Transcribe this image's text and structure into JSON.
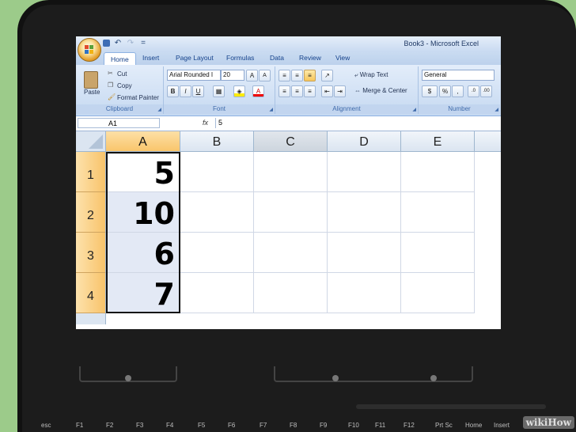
{
  "window": {
    "title": "Book3 - Microsoft Excel"
  },
  "quick_access": {
    "icons": [
      "save-icon",
      "undo-icon",
      "redo-icon"
    ],
    "undo_glyph": "↶",
    "redo_glyph": "↷",
    "more_glyph": "="
  },
  "tabs": [
    "Home",
    "Insert",
    "Page Layout",
    "Formulas",
    "Data",
    "Review",
    "View"
  ],
  "ribbon": {
    "clipboard": {
      "label": "Clipboard",
      "paste": "Paste",
      "cut": "Cut",
      "copy": "Copy",
      "format_painter": "Format Painter"
    },
    "font": {
      "label": "Font",
      "family": "Arial Rounded I",
      "size": "20",
      "bold": "B",
      "italic": "I",
      "underline": "U"
    },
    "alignment": {
      "label": "Alignment",
      "wrap_text": "Wrap Text",
      "merge_center": "Merge & Center"
    },
    "number": {
      "label": "Number",
      "format": "General",
      "percent": "%",
      "comma": ","
    }
  },
  "formula_bar": {
    "name_box": "A1",
    "fx": "fx",
    "value": "5"
  },
  "sheet": {
    "columns": [
      "A",
      "B",
      "C",
      "D",
      "E"
    ],
    "rows": [
      "1",
      "2",
      "3",
      "4"
    ],
    "column_a_values": [
      "5",
      "10",
      "6",
      "7"
    ]
  },
  "keyboard": {
    "keys": [
      "esc",
      "F1",
      "F2",
      "F3",
      "F4",
      "F5",
      "F6",
      "F7",
      "F8",
      "F9",
      "F10",
      "F11",
      "F12",
      "Prt Sc",
      "Home",
      "Insert"
    ]
  },
  "watermark": "wikiHow",
  "colors": {
    "selected_header": "#f9c56b",
    "ribbon": "#c6d9f1",
    "background": "#9ccb8a"
  }
}
